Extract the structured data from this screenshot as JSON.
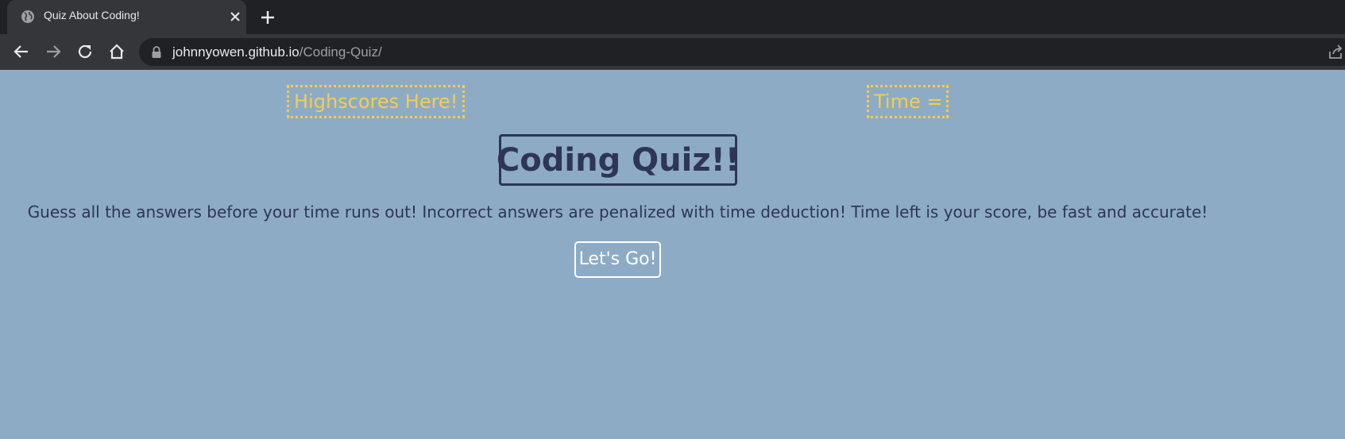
{
  "browser": {
    "tab": {
      "title": "Quiz About Coding!",
      "favicon": "globe-icon"
    },
    "address_bar": {
      "host": "johnnyowen.github.io",
      "path": "/Coding-Quiz/"
    },
    "icons": {
      "back": "back-arrow-icon",
      "forward": "forward-arrow-icon",
      "reload": "reload-icon",
      "home": "home-icon",
      "lock": "lock-icon",
      "share": "share-icon",
      "close_tab": "close-icon",
      "new_tab": "plus-icon"
    }
  },
  "page": {
    "highscores_label": "Highscores Here!",
    "timer_label": "Time =",
    "title": "Coding Quiz!!",
    "description": "Guess all the answers before your time runs out! Incorrect answers are penalized with time deduction! Time left is your score, be fast and accurate!",
    "start_button_label": "Let's Go!"
  },
  "colors": {
    "page_background": "#8dabc4",
    "accent_yellow": "#f5cd4f",
    "text_navy": "#2e3557",
    "button_white": "#ffffff"
  }
}
